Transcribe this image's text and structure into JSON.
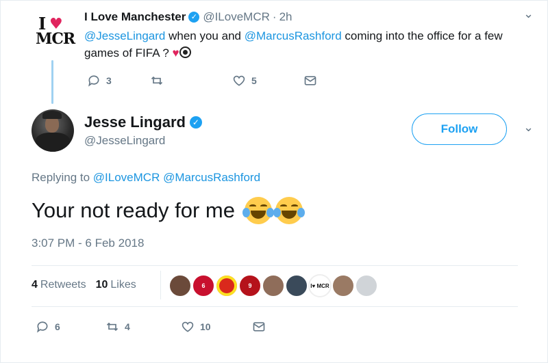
{
  "parent_tweet": {
    "avatar_logo": {
      "line1": "I",
      "heart": "♥",
      "line2": "MCR"
    },
    "display_name": "I Love Manchester",
    "handle": "@ILoveMCR",
    "separator": "·",
    "time": "2h",
    "text_segments": {
      "mention1": "@JesseLingard",
      "part1": " when you and ",
      "mention2": "@MarcusRashford",
      "part2": " coming into the office for a few games of FIFA ? ",
      "emoji_heart": "♥"
    },
    "actions": {
      "reply_count": "3",
      "retweet_count": "",
      "like_count": "5"
    }
  },
  "reply_tweet": {
    "display_name": "Jesse Lingard",
    "handle": "@JesseLingard",
    "follow_label": "Follow",
    "replying_prefix": "Replying to ",
    "replying_mention1": "@ILoveMCR",
    "replying_mention2": "@MarcusRashford",
    "text": "Your not ready for me",
    "timestamp": "3:07 PM - 6 Feb 2018",
    "stats": {
      "retweets_count": "4",
      "retweets_label": "Retweets",
      "likes_count": "10",
      "likes_label": "Likes"
    },
    "likers": [
      {
        "icon": "avatar",
        "label": "",
        "color": "#6b4a3a"
      },
      {
        "icon": "avatar",
        "label": "6",
        "color": "#c8102e"
      },
      {
        "icon": "club-crest",
        "label": "",
        "color": "#da291c"
      },
      {
        "icon": "avatar",
        "label": "9",
        "color": "#b5121b"
      },
      {
        "icon": "avatar",
        "label": "",
        "color": "#8f6d5a"
      },
      {
        "icon": "avatar",
        "label": "",
        "color": "#3a4a5a"
      },
      {
        "icon": "mcr-logo",
        "label": "I♥ MCR",
        "color": "#ffffff"
      },
      {
        "icon": "avatar",
        "label": "",
        "color": "#9a7a64"
      },
      {
        "icon": "avatar",
        "label": "",
        "color": "#d0d4d8"
      }
    ],
    "actions": {
      "reply_count": "6",
      "retweet_count": "4",
      "like_count": "10"
    }
  },
  "colors": {
    "accent": "#1da1f2",
    "mention": "#1b95e0",
    "muted": "#657786",
    "text": "#14171a",
    "heart": "#e0245e"
  }
}
